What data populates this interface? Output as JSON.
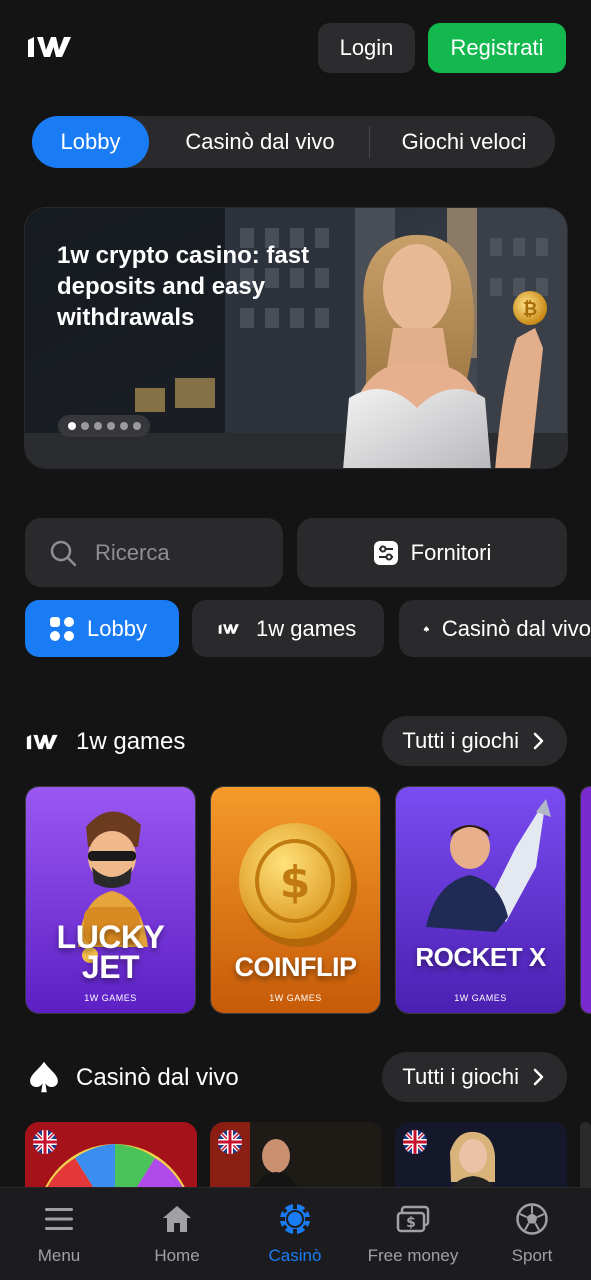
{
  "header": {
    "login_label": "Login",
    "register_label": "Registrati"
  },
  "top_tabs": [
    {
      "label": "Lobby",
      "active": true
    },
    {
      "label": "Casinò dal vivo",
      "active": false
    },
    {
      "label": "Giochi veloci",
      "active": false
    }
  ],
  "banner": {
    "title": "1w crypto casino: fast deposits and easy withdrawals",
    "slide_count": 6,
    "active_slide": 1
  },
  "search": {
    "placeholder": "Ricerca"
  },
  "providers": {
    "label": "Fornitori"
  },
  "category_chips": [
    {
      "label": "Lobby",
      "icon": "grid-icon",
      "active": true
    },
    {
      "label": "1w games",
      "icon": "1w-logo-icon",
      "active": false
    },
    {
      "label": "Casinò dal vivo",
      "icon": "spade-icon",
      "active": false
    }
  ],
  "sections": {
    "games": {
      "title": "1w games",
      "see_all": "Tutti i giochi",
      "cards": [
        {
          "name_line1": "LUCKY",
          "name_line2": "JET",
          "provider": "1W GAMES"
        },
        {
          "name_line1": "COINFLIP",
          "name_line2": "",
          "provider": "1W GAMES"
        },
        {
          "name_line1": "ROCKET X",
          "name_line2": "",
          "provider": "1W GAMES"
        }
      ]
    },
    "live": {
      "title": "Casinò dal vivo",
      "see_all": "Tutti i giochi"
    }
  },
  "bottom_nav": [
    {
      "label": "Menu",
      "icon": "menu-icon",
      "active": false
    },
    {
      "label": "Home",
      "icon": "home-icon",
      "active": false
    },
    {
      "label": "Casinò",
      "icon": "casino-chip-icon",
      "active": true
    },
    {
      "label": "Free money",
      "icon": "money-icon",
      "active": false
    },
    {
      "label": "Sport",
      "icon": "soccer-ball-icon",
      "active": false
    }
  ],
  "colors": {
    "accent_blue": "#1a7cf5",
    "register_green": "#13b84f",
    "background": "#141414",
    "surface": "#2a2a2c"
  }
}
